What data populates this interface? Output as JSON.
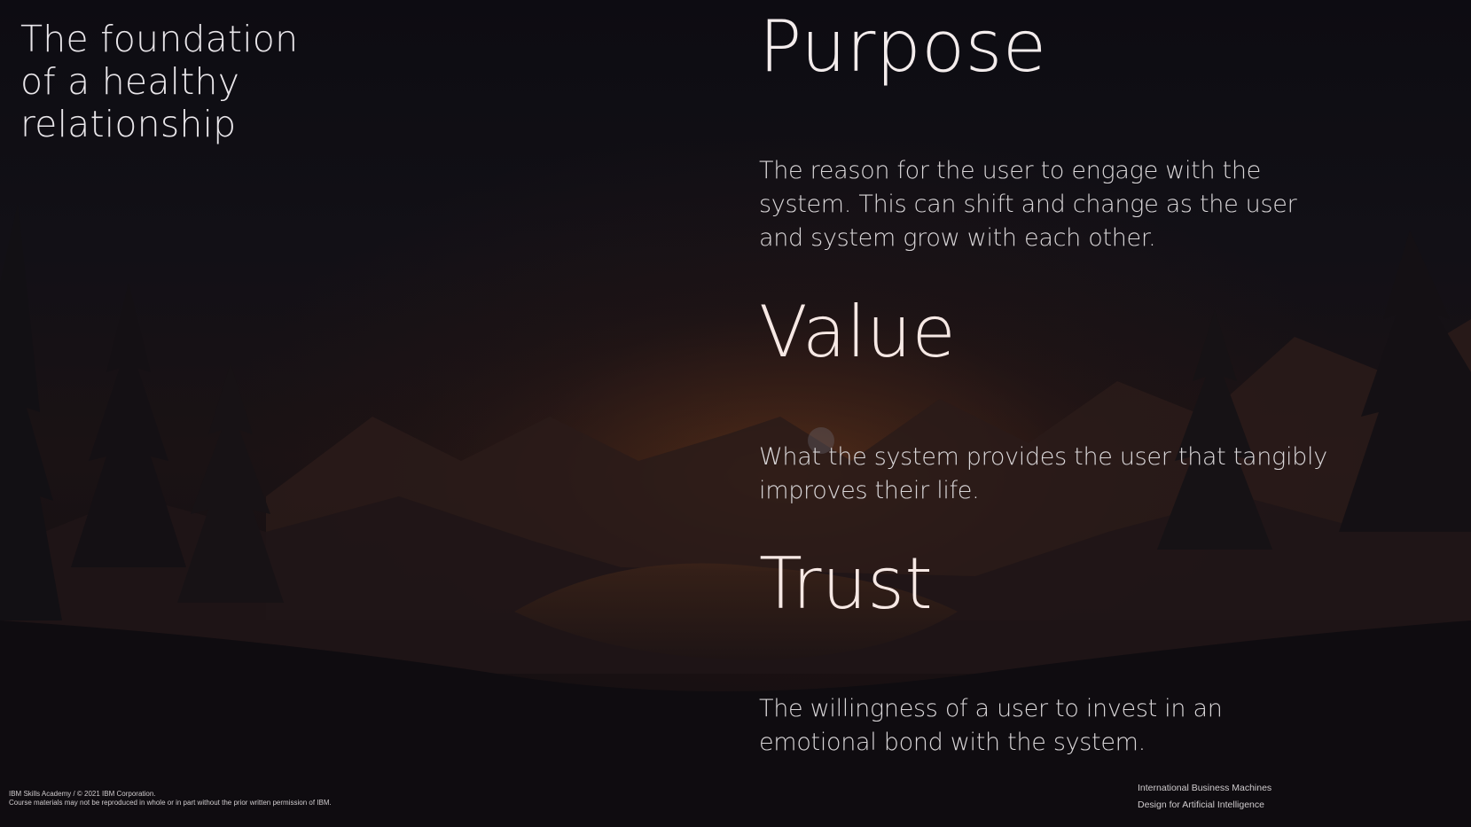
{
  "slide": {
    "headline": "The foundation\nof a healthy\nrelationship",
    "concepts": [
      {
        "title": "Purpose",
        "description": "The reason for the user to engage with the system. This can shift and change as the user and system grow with each other."
      },
      {
        "title": "Value",
        "description": "What the system provides the user that tangibly improves their life."
      },
      {
        "title": "Trust",
        "description": "The willingness of a user to invest in an emotional bond with the system."
      }
    ],
    "footer_left": {
      "line1": "IBM Skills Academy / © 2021 IBM Corporation.",
      "line2": "Course materials may not be reproduced in whole or in part without the prior written permission of IBM."
    },
    "footer_right": {
      "line1": "International Business Machines",
      "line2": "Design for Artificial Intelligence"
    }
  },
  "colors": {
    "background": "#0b0a0f",
    "sunset_glow": "#5a2e18",
    "text_primary": "#f3ecec",
    "text_body": "#d9d6d8"
  }
}
